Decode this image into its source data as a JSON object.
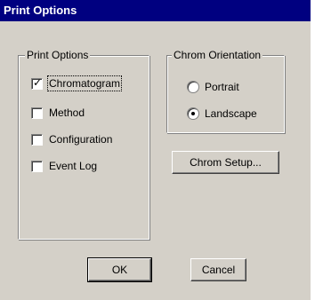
{
  "window": {
    "title": "Print Options"
  },
  "print_options": {
    "legend": "Print Options",
    "items": [
      {
        "label": "Chromatogram",
        "checked": true
      },
      {
        "label": "Method",
        "checked": false
      },
      {
        "label": "Configuration",
        "checked": false
      },
      {
        "label": "Event Log",
        "checked": false
      }
    ]
  },
  "orientation": {
    "legend": "Chrom Orientation",
    "options": [
      {
        "label": "Portrait",
        "selected": false
      },
      {
        "label": "Landscape",
        "selected": true
      }
    ]
  },
  "buttons": {
    "chrom_setup": "Chrom Setup...",
    "ok": "OK",
    "cancel": "Cancel"
  },
  "glyphs": {
    "check": "✓"
  },
  "colors": {
    "titlebar": "#000080",
    "face": "#d4d0c8"
  }
}
